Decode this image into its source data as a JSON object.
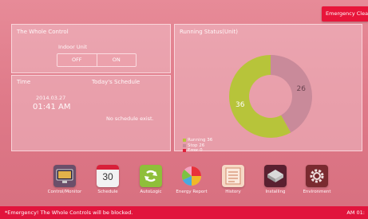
{
  "top_bar": {
    "emergency_button": "Emergency Clea"
  },
  "whole_control": {
    "title": "The Whole Control",
    "indoor_unit_label": "Indoor Unit",
    "off_label": "OFF",
    "on_label": "ON"
  },
  "time_panel": {
    "time_heading": "Time",
    "schedule_heading": "Today's Schedule",
    "date": "2014.03.27",
    "time": "01:41 AM",
    "no_schedule": "No schedule exist."
  },
  "running_status": {
    "title": "Running Status(Unit)",
    "colors": {
      "running": "#b7c43a",
      "stop": "#c98a9a",
      "error": "#e0203a"
    }
  },
  "chart_data": {
    "type": "pie",
    "title": "Running Status(Unit)",
    "categories": [
      "Running",
      "Stop",
      "Error"
    ],
    "values": [
      36,
      26,
      0
    ],
    "slice_labels": [
      "36",
      "26"
    ],
    "legend": [
      "Running 36",
      "Stop 26",
      "Error 0"
    ]
  },
  "dock": {
    "items": [
      {
        "label": "Control/Monitor",
        "icon": "monitor-icon"
      },
      {
        "label": "Schedule",
        "icon": "calendar-icon",
        "icon_text": "30"
      },
      {
        "label": "AutoLogic",
        "icon": "refresh-icon"
      },
      {
        "label": "Energy Report",
        "icon": "pie-chart-icon"
      },
      {
        "label": "History",
        "icon": "history-list-icon"
      },
      {
        "label": "Installing",
        "icon": "installing-icon"
      },
      {
        "label": "Environment",
        "icon": "gear-icon"
      }
    ]
  },
  "bottom_bar": {
    "message": "*Emergency! The Whole Controls will be blocked.",
    "clock": "AM 01:"
  }
}
